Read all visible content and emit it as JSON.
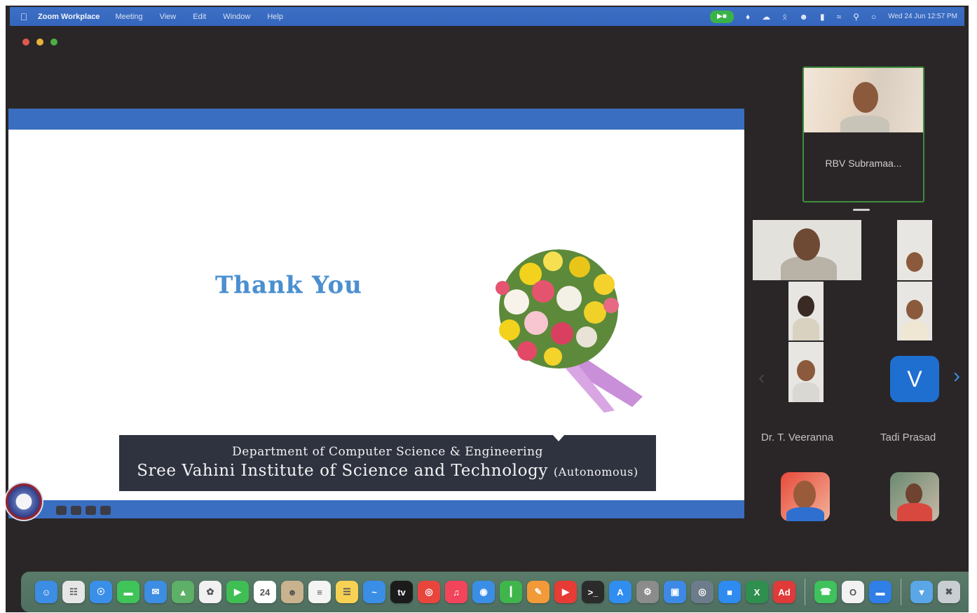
{
  "menubar": {
    "apple_icon": "apple-icon",
    "app_name": "Zoom Workplace",
    "menus": [
      "Meeting",
      "View",
      "Edit",
      "Window",
      "Help"
    ],
    "status_icons": [
      "zoom-video-icon",
      "dropbox-icon",
      "creative-cloud-icon",
      "bluetooth-icon",
      "user-icon",
      "battery-icon",
      "wifi-icon",
      "search-icon",
      "control-center-icon"
    ],
    "clock": "Wed 24 Jun  12:57 PM"
  },
  "slide": {
    "title": "Thank You",
    "department": "Department of Computer Science & Engineering",
    "institute": "Sree Vahini Institute of Science and Technology",
    "institute_suffix": "(Autonomous)"
  },
  "participants": {
    "active_speaker": "RBV Subramaa...",
    "avatar_letter": "V",
    "names": [
      "Dr. T. Veeranna",
      "Tadi Prasad"
    ]
  },
  "dock": {
    "apps": [
      {
        "name": "finder-icon",
        "glyph": "☺",
        "color": "#3c8de3"
      },
      {
        "name": "launchpad-icon",
        "glyph": "☷",
        "color": "#e6e6e6"
      },
      {
        "name": "safari-icon",
        "glyph": "☉",
        "color": "#3a8fe8"
      },
      {
        "name": "messages-icon",
        "glyph": "▬",
        "color": "#3fc45a"
      },
      {
        "name": "mail-icon",
        "glyph": "✉",
        "color": "#3c8de3"
      },
      {
        "name": "maps-icon",
        "glyph": "▲",
        "color": "#5db067"
      },
      {
        "name": "photos-icon",
        "glyph": "✿",
        "color": "#f1f1f1"
      },
      {
        "name": "facetime-icon",
        "glyph": "▶",
        "color": "#3fbe53"
      },
      {
        "name": "calendar-icon",
        "glyph": "24",
        "color": "#ffffff"
      },
      {
        "name": "contacts-icon",
        "glyph": "☻",
        "color": "#c9b38f"
      },
      {
        "name": "reminders-icon",
        "glyph": "≡",
        "color": "#f4f4f4"
      },
      {
        "name": "notes-icon",
        "glyph": "☰",
        "color": "#f6d154"
      },
      {
        "name": "freeform-icon",
        "glyph": "~",
        "color": "#3a8ee6"
      },
      {
        "name": "apple-tv-icon",
        "glyph": "tv",
        "color": "#1b1b1b"
      },
      {
        "name": "chrome-icon",
        "glyph": "◎",
        "color": "#e8453c"
      },
      {
        "name": "music-icon",
        "glyph": "♫",
        "color": "#f2445a"
      },
      {
        "name": "podcasts-icon",
        "glyph": "◉",
        "color": "#3a8ee6"
      },
      {
        "name": "numbers-icon",
        "glyph": "┃",
        "color": "#3fb54c"
      },
      {
        "name": "pages-icon",
        "glyph": "✎",
        "color": "#f29a37"
      },
      {
        "name": "youtube-icon",
        "glyph": "▶",
        "color": "#e73b35"
      },
      {
        "name": "terminal-icon",
        "glyph": ">_",
        "color": "#2b2b2b"
      },
      {
        "name": "app-store-icon",
        "glyph": "A",
        "color": "#2f8ef0"
      },
      {
        "name": "system-settings-icon",
        "glyph": "⚙",
        "color": "#8c8c8c"
      },
      {
        "name": "preview-icon",
        "glyph": "▣",
        "color": "#3d8ae6"
      },
      {
        "name": "screenshot-icon",
        "glyph": "◎",
        "color": "#6d7c8a"
      },
      {
        "name": "zoom-app-icon",
        "glyph": "■",
        "color": "#2e8bf0"
      },
      {
        "name": "excel-icon",
        "glyph": "X",
        "color": "#2f8f4e"
      },
      {
        "name": "acrobat-icon",
        "glyph": "Ad",
        "color": "#e03a3a"
      },
      {
        "name": "whatsapp-icon",
        "glyph": "☎",
        "color": "#3fc25c"
      },
      {
        "name": "opera-icon",
        "glyph": "O",
        "color": "#f2f2f2"
      },
      {
        "name": "zoom-launcher-icon",
        "glyph": "▬",
        "color": "#2f7fe6"
      },
      {
        "name": "downloads-folder-icon",
        "glyph": "▼",
        "color": "#5aa6e6"
      },
      {
        "name": "trash-icon",
        "glyph": "✖",
        "color": "#c9ced2"
      }
    ]
  }
}
